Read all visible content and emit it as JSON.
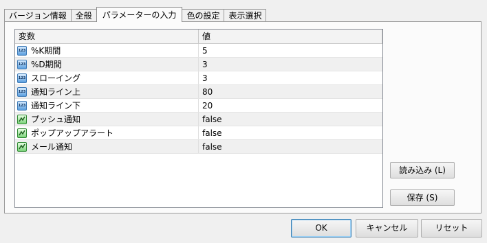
{
  "tabs": [
    {
      "label": "バージョン情報"
    },
    {
      "label": "全般"
    },
    {
      "label": "パラメーターの入力"
    },
    {
      "label": "色の設定"
    },
    {
      "label": "表示選択"
    }
  ],
  "grid": {
    "columns": {
      "variable": "変数",
      "value": "値"
    },
    "rows": [
      {
        "name": "%K期間",
        "value": "5",
        "icon": "123"
      },
      {
        "name": "%D期間",
        "value": "3",
        "icon": "123"
      },
      {
        "name": "スローイング",
        "value": "3",
        "icon": "123"
      },
      {
        "name": "通知ライン上",
        "value": "80",
        "icon": "123"
      },
      {
        "name": "通知ライン下",
        "value": "20",
        "icon": "123"
      },
      {
        "name": "プッシュ通知",
        "value": "false",
        "icon": "boolean-icon"
      },
      {
        "name": "ポップアップアラート",
        "value": "false",
        "icon": "boolean-icon"
      },
      {
        "name": "メール通知",
        "value": "false",
        "icon": "boolean-icon"
      }
    ]
  },
  "side_buttons": {
    "load": "読み込み (L)",
    "save": "保存 (S)"
  },
  "footer": {
    "ok": "OK",
    "cancel": "キャンセル",
    "reset": "リセット"
  }
}
